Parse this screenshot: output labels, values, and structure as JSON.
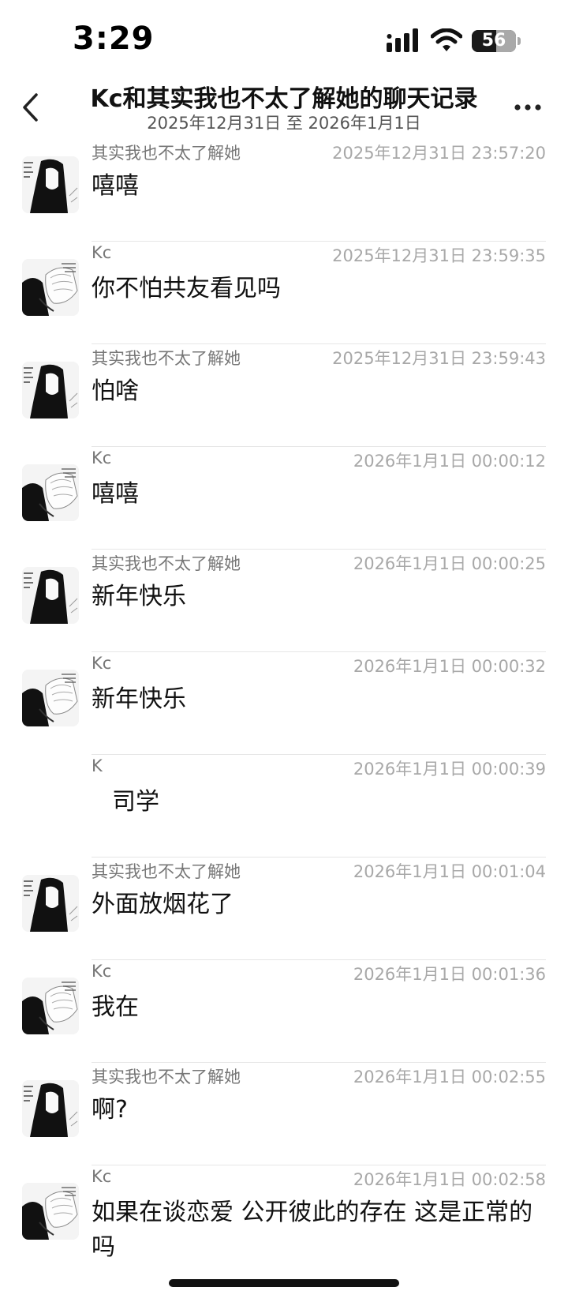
{
  "status_bar": {
    "time": "3:29",
    "battery": "56",
    "battery_level": 0.56,
    "icons": [
      "signal-icon",
      "wifi-icon",
      "battery-icon"
    ]
  },
  "header": {
    "title": "Kc和其实我也不太了解她的聊天记录",
    "subtitle": "2025年12月31日 至 2026年1月1日",
    "icons": [
      "back-icon",
      "more-icon"
    ]
  },
  "messages": [
    {
      "sender": "其实我也不太了解她",
      "time": "2025年12月31日 23:57:20",
      "text": "嘻嘻",
      "avatar": "avatar-her"
    },
    {
      "sender": "Kc",
      "time": "2025年12月31日 23:59:35",
      "text": "你不怕共友看见吗",
      "avatar": "avatar-kc"
    },
    {
      "sender": "其实我也不太了解她",
      "time": "2025年12月31日 23:59:43",
      "text": "怕啥",
      "avatar": "avatar-her"
    },
    {
      "sender": "Kc",
      "time": "2026年1月1日 00:00:12",
      "text": "嘻嘻",
      "avatar": "avatar-kc"
    },
    {
      "sender": "其实我也不太了解她",
      "time": "2026年1月1日 00:00:25",
      "text": "新年快乐",
      "avatar": "avatar-her"
    },
    {
      "sender": "Kc",
      "time": "2026年1月1日 00:00:32",
      "text": "新年快乐",
      "avatar": "avatar-kc"
    },
    {
      "sender": "K",
      "time": "2026年1月1日 00:00:39",
      "text": "司学",
      "avatar": ""
    },
    {
      "sender": "其实我也不太了解她",
      "time": "2026年1月1日 00:01:04",
      "text": "外面放烟花了",
      "avatar": "avatar-her"
    },
    {
      "sender": "Kc",
      "time": "2026年1月1日 00:01:36",
      "text": "我在",
      "avatar": "avatar-kc"
    },
    {
      "sender": "其实我也不太了解她",
      "time": "2026年1月1日 00:02:55",
      "text": "啊?",
      "avatar": "avatar-her"
    },
    {
      "sender": "Kc",
      "time": "2026年1月1日 00:02:58",
      "text": "如果在谈恋爱 公开彼此的存在 这是正常的吗",
      "avatar": "avatar-kc"
    }
  ]
}
